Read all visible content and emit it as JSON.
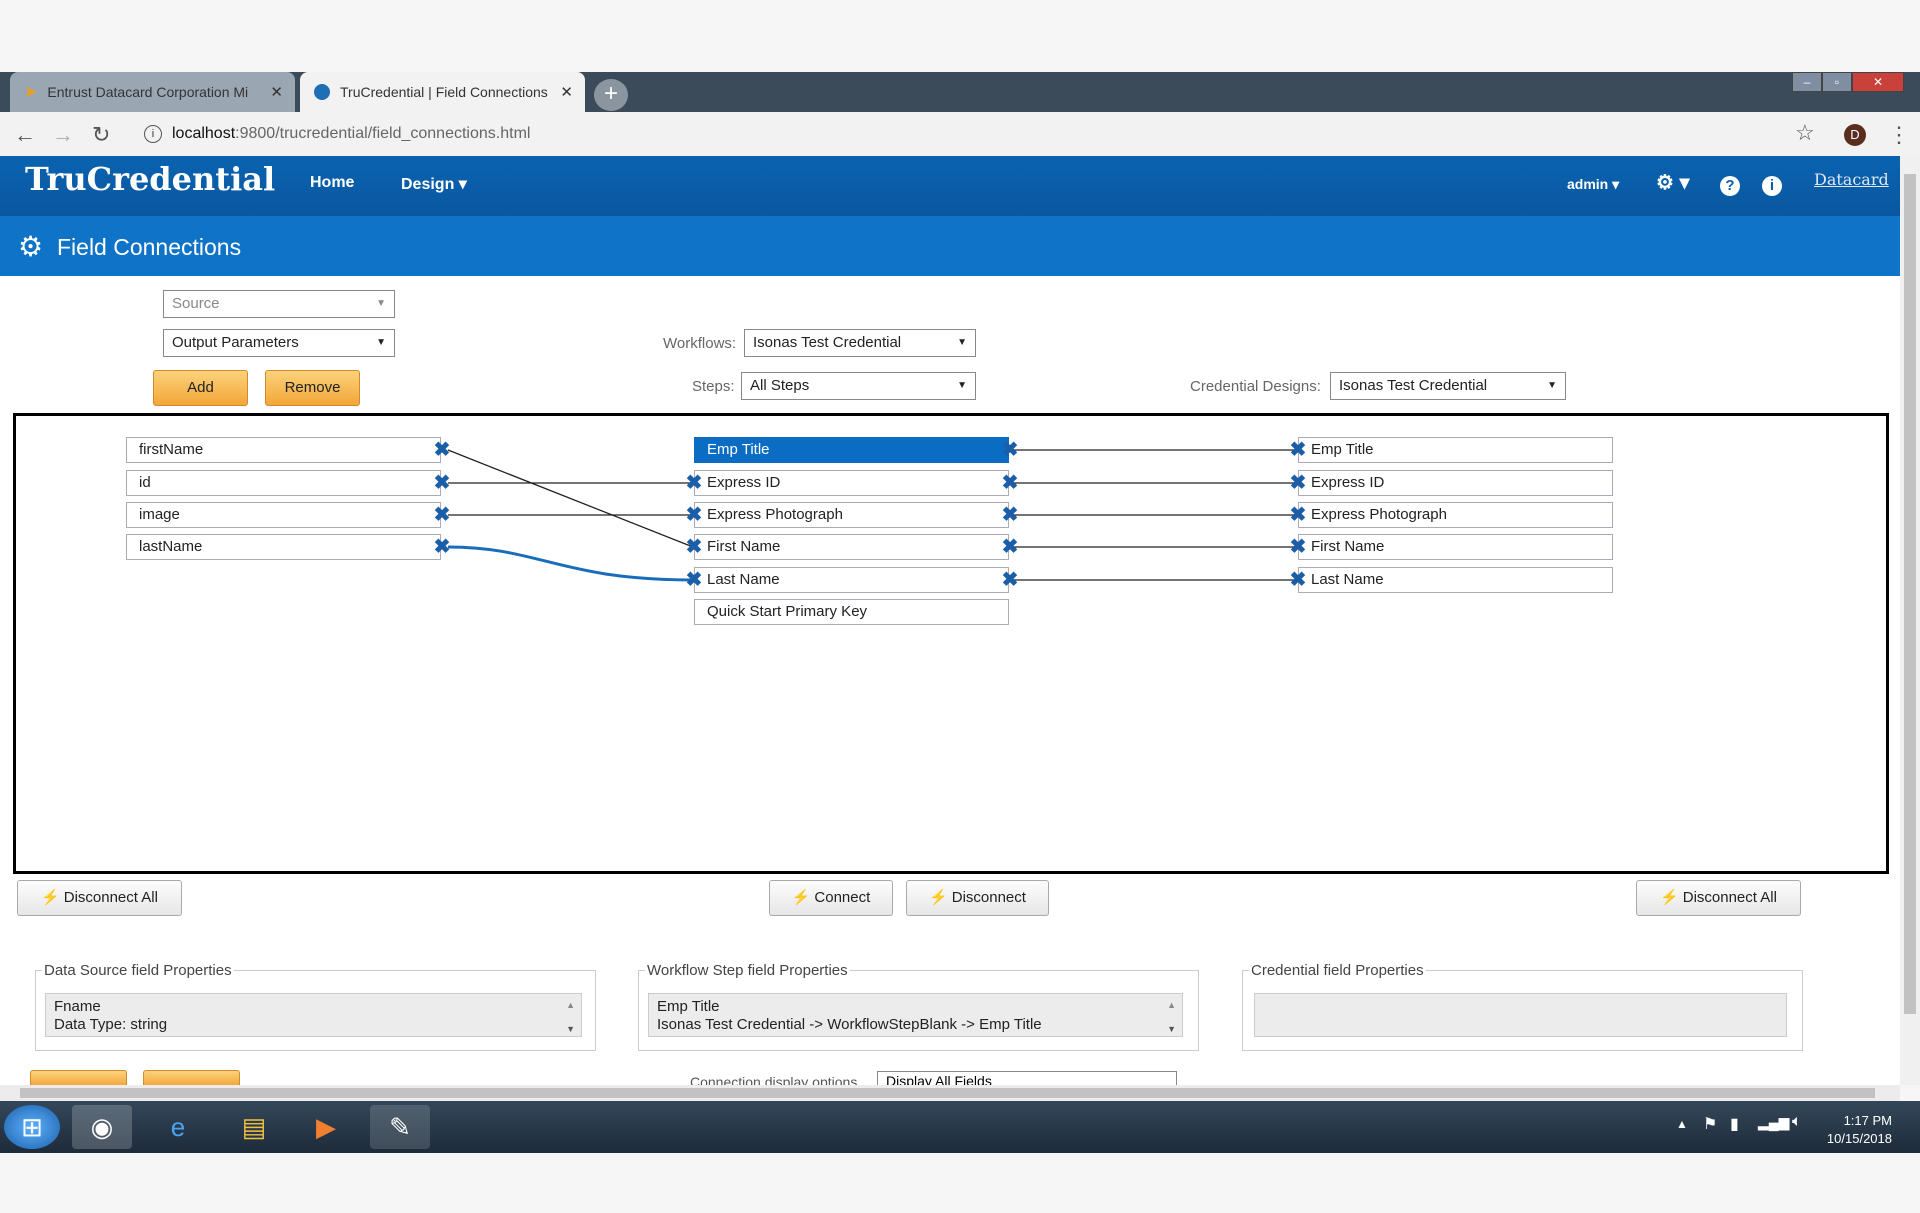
{
  "browser": {
    "tabs": [
      {
        "title": "Entrust Datacard Corporation Mi",
        "close": "✕"
      },
      {
        "title": "TruCredential | Field Connections",
        "close": "✕"
      }
    ],
    "new_tab": "+",
    "url_host": "localhost",
    "url_rest": ":9800/trucredential/field_connections.html",
    "profile_initial": "D",
    "window_controls": [
      "–",
      "▫",
      "✕"
    ]
  },
  "app": {
    "logo": "TruCredential",
    "nav": {
      "home": "Home",
      "design": "Design ▾"
    },
    "user": "admin ▾",
    "settings": "⚙ ▾",
    "brand": "Datacard"
  },
  "page_title": "Field Connections",
  "controls": {
    "source_placeholder": "Source",
    "output_select": "Output Parameters",
    "add": "Add",
    "remove": "Remove",
    "workflows_label": "Workflows:",
    "workflows_value": "Isonas Test Credential",
    "steps_label": "Steps:",
    "steps_value": "All Steps",
    "designs_label": "Credential Designs:",
    "designs_value": "Isonas Test Credential"
  },
  "source_fields": [
    "firstName",
    "id",
    "image",
    "lastName"
  ],
  "workflow_fields": [
    "Emp Title",
    "Express ID",
    "Express Photograph",
    "First Name",
    "Last Name",
    "Quick Start Primary Key"
  ],
  "credential_fields": [
    "Emp Title",
    "Express ID",
    "Express Photograph",
    "First Name",
    "Last Name"
  ],
  "selected_workflow_field": "Emp Title",
  "buttons": {
    "disconnect_all_left": "Disconnect All",
    "connect": "Connect",
    "disconnect": "Disconnect",
    "disconnect_all_right": "Disconnect All"
  },
  "properties": {
    "data_source": {
      "legend": "Data Source field Properties",
      "line1": "Fname",
      "line2": "Data Type: string"
    },
    "workflow_step": {
      "legend": "Workflow Step field Properties",
      "line1": "Emp Title",
      "line2": "Isonas Test Credential -> WorkflowStepBlank -> Emp Title"
    },
    "credential": {
      "legend": "Credential field Properties",
      "line1": "",
      "line2": ""
    }
  },
  "display_options": {
    "label": "Connection display options",
    "value": "Display All Fields"
  },
  "taskbar": {
    "time": "1:17 PM",
    "date": "10/15/2018"
  },
  "colors": {
    "header": "#0a5fab",
    "title_bar": "#0f74c8",
    "accent_orange": "#f3a63a",
    "connector_blue": "#1a5ea8"
  }
}
